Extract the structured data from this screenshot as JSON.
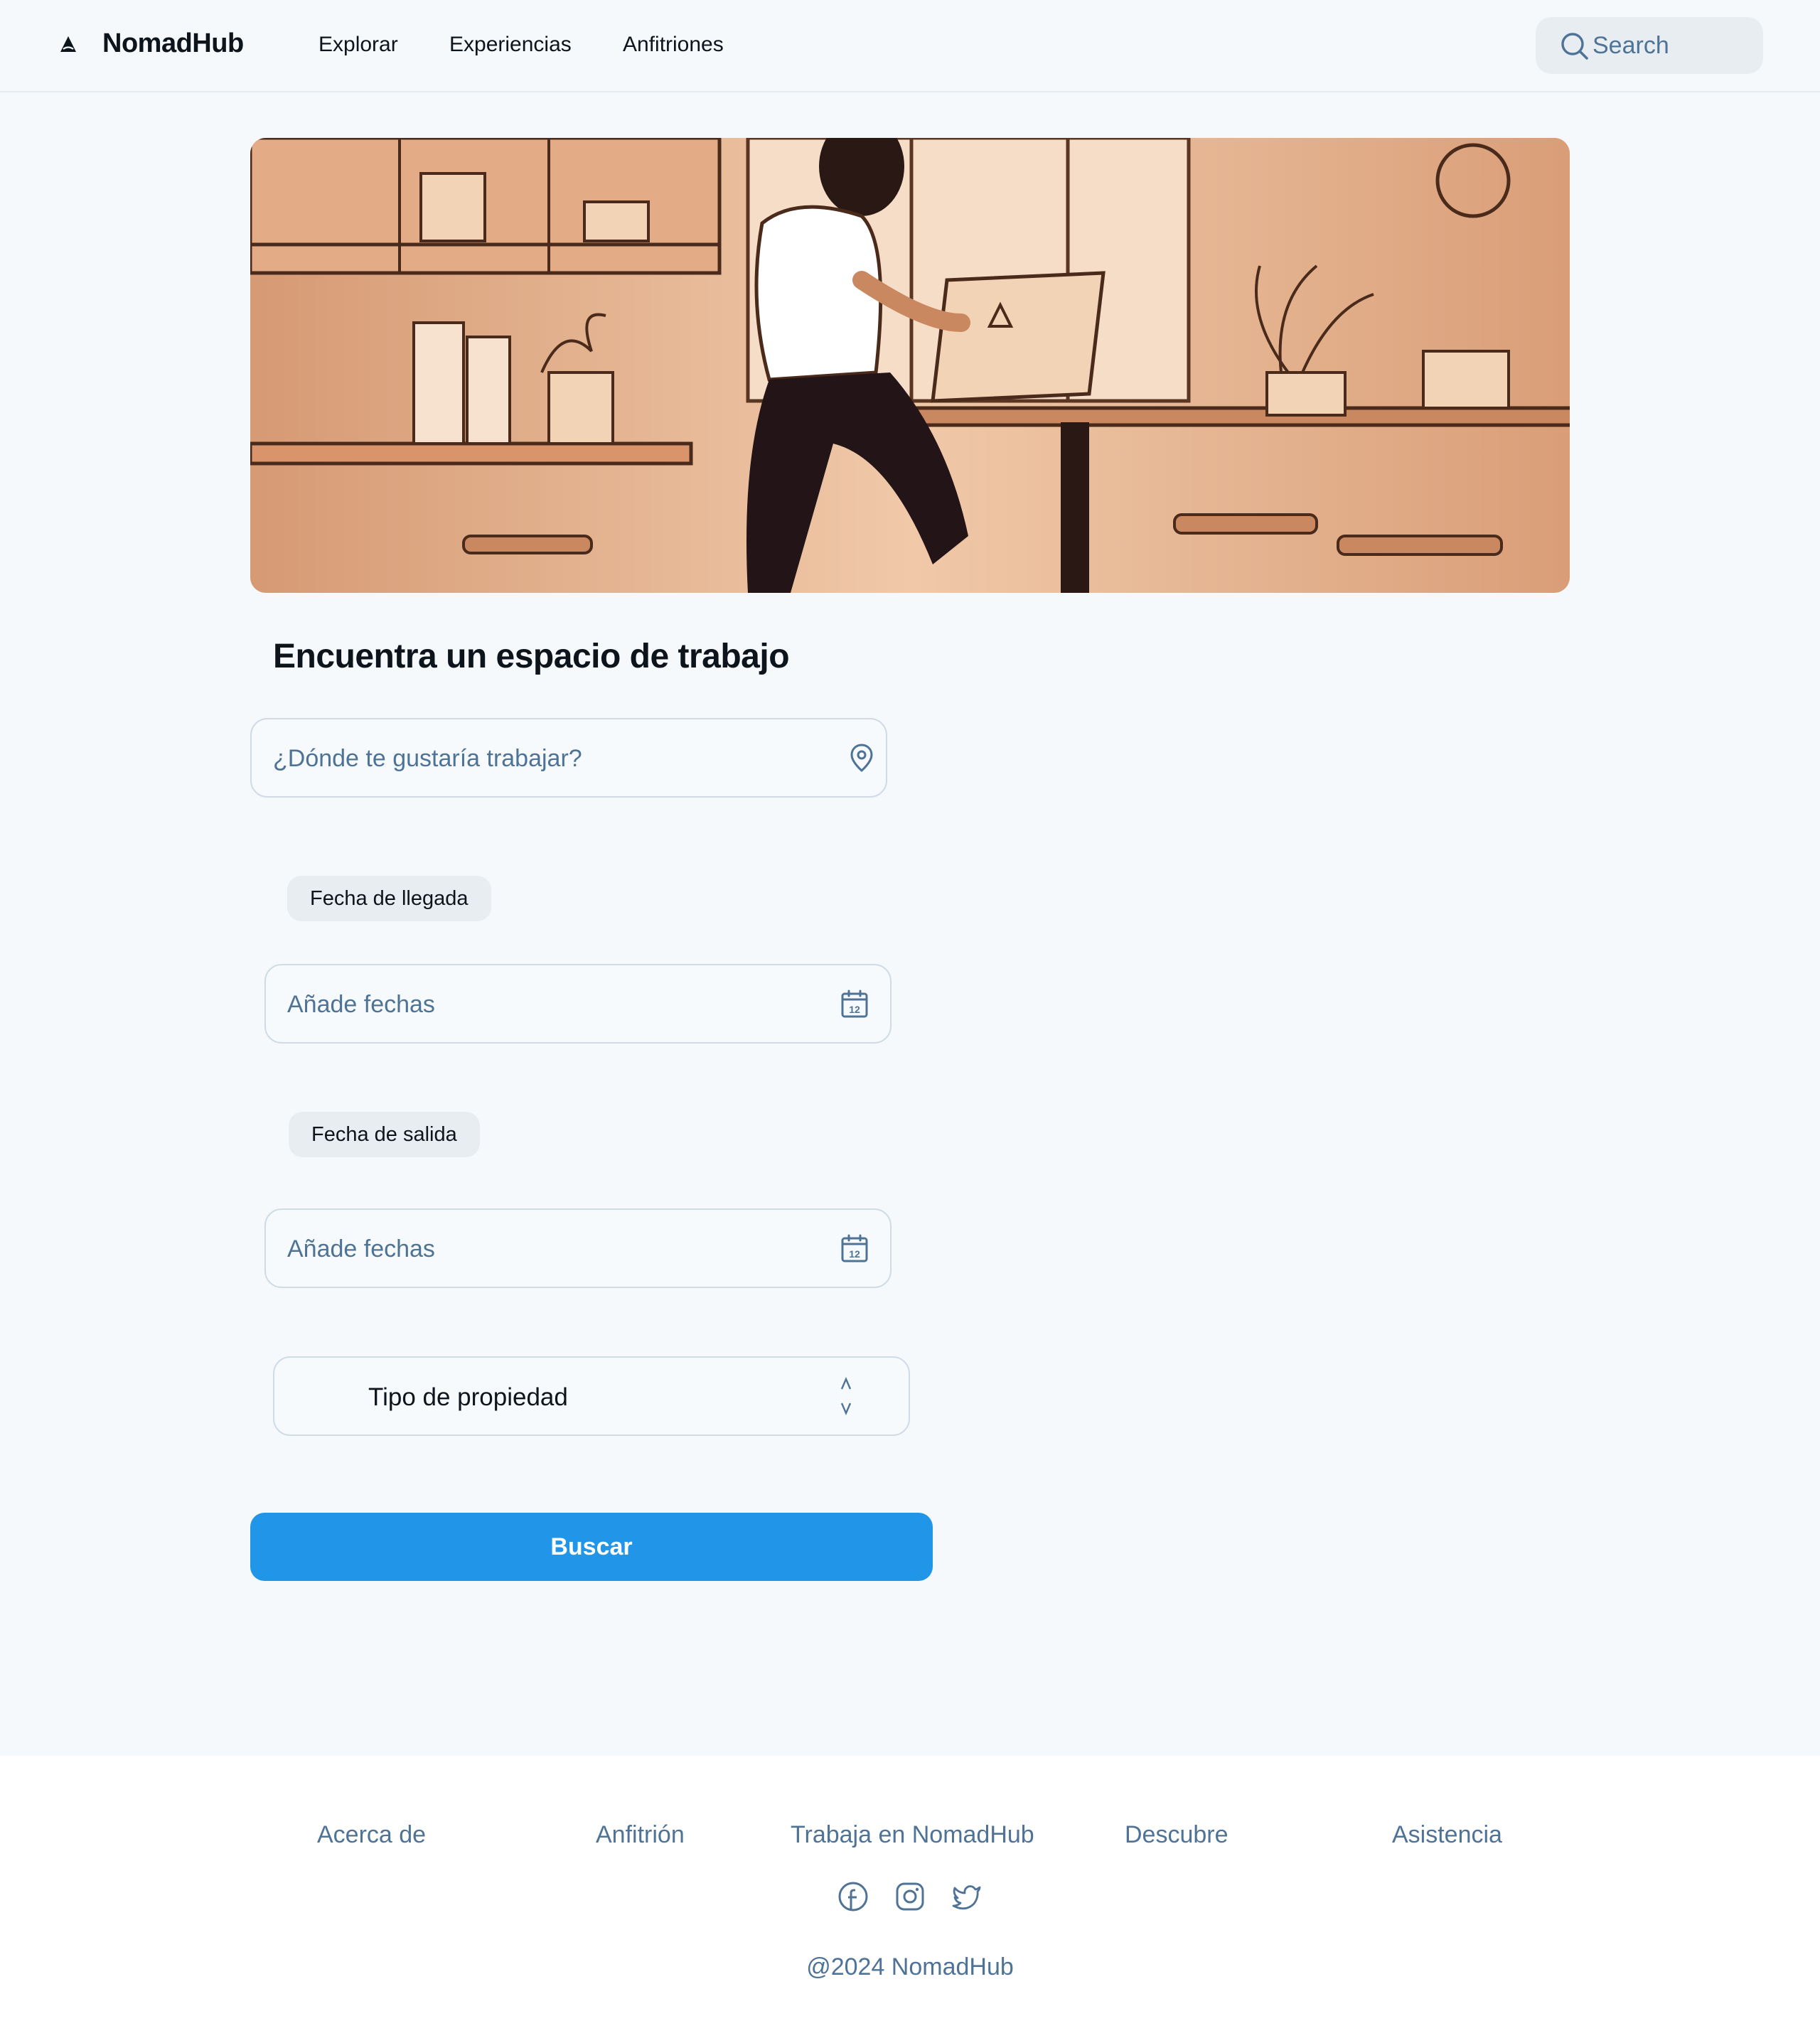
{
  "header": {
    "brand": "NomadHub",
    "nav": [
      {
        "label": "Explorar"
      },
      {
        "label": "Experiencias"
      },
      {
        "label": "Anfitriones"
      }
    ],
    "search_placeholder": "Search"
  },
  "hero": {
    "icon": "illustration-woman-working-laptop-cafe"
  },
  "form": {
    "title": "Encuentra un espacio de trabajo",
    "location_placeholder": "¿Dónde te gustaría trabajar?",
    "arrival_label": "Fecha de llegada",
    "arrival_placeholder": "Añade fechas",
    "departure_label": "Fecha de salida",
    "departure_placeholder": "Añade fechas",
    "calendar_day": "12",
    "property_type": "Tipo de propiedad",
    "submit_label": "Buscar"
  },
  "footer": {
    "links": [
      {
        "label": "Acerca de"
      },
      {
        "label": "Anfitrión"
      },
      {
        "label": "Trabaja en NomadHub"
      },
      {
        "label": "Descubre"
      },
      {
        "label": "Asistencia"
      }
    ],
    "social": [
      "facebook-icon",
      "instagram-icon",
      "twitter-icon"
    ],
    "copyright": "@2024 NomadHub"
  },
  "colors": {
    "primary": "#2196e8",
    "muted_text": "#4f7396",
    "background": "#f5f9fc",
    "border": "#d0dbe7"
  }
}
